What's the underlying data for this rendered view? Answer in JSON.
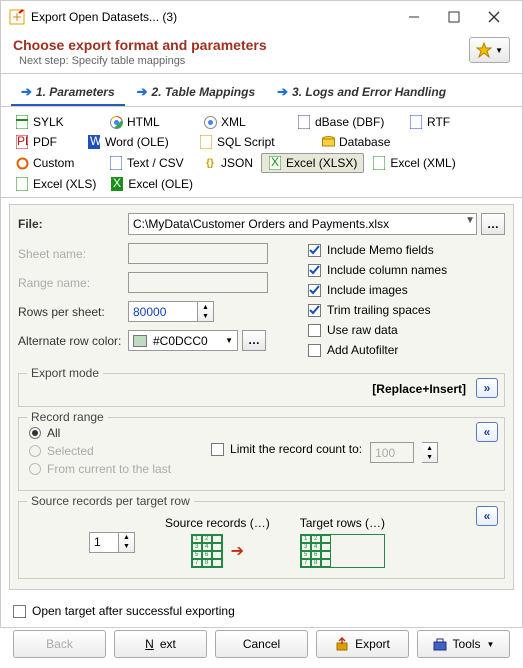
{
  "window": {
    "title": "Export Open Datasets... (3)"
  },
  "header": {
    "title": "Choose export format and parameters",
    "subtitle": "Next step: Specify table mappings"
  },
  "tabs": [
    {
      "label": "1. Parameters",
      "active": true
    },
    {
      "label": "2. Table Mappings",
      "active": false
    },
    {
      "label": "3. Logs and Error Handling",
      "active": false
    }
  ],
  "formats": [
    {
      "label": "SYLK",
      "color": "#1a8f1a"
    },
    {
      "label": "HTML",
      "color": "#e04020"
    },
    {
      "label": "XML",
      "color": "#e04020"
    },
    {
      "label": "dBase (DBF)",
      "color": "#5a3fa0"
    },
    {
      "label": "RTF",
      "color": "#2050c0"
    },
    {
      "label": "PDF",
      "color": "#c01515"
    },
    {
      "label": "Word (OLE)",
      "color": "#2050c0"
    },
    {
      "label": "SQL Script",
      "color": "#cc9900"
    },
    {
      "label": "Database",
      "color": "#cc9900"
    },
    {
      "label": "Custom",
      "color": "#e06000"
    },
    {
      "label": "Text / CSV",
      "color": "#2050c0"
    },
    {
      "label": "JSON",
      "color": "#cc9900"
    },
    {
      "label": "Excel (XLSX)",
      "color": "#1a8f1a",
      "selected": true
    },
    {
      "label": "Excel (XML)",
      "color": "#1a8f1a"
    },
    {
      "label": "Excel (XLS)",
      "color": "#1a8f1a"
    },
    {
      "label": "Excel (OLE)",
      "color": "#1a8f1a"
    }
  ],
  "file": {
    "label": "File:",
    "value": "C:\\MyData\\Customer Orders and Payments.xlsx"
  },
  "sheet": {
    "label": "Sheet name:",
    "value": ""
  },
  "range": {
    "label": "Range name:",
    "value": ""
  },
  "rows_per_sheet": {
    "label": "Rows per sheet:",
    "value": "80000"
  },
  "alt_color": {
    "label": "Alternate row color:",
    "value": "#C0DCC0",
    "swatch": "#C0DCC0"
  },
  "options": {
    "memo": {
      "label": "Include Memo fields",
      "checked": true
    },
    "cols": {
      "label": "Include column names",
      "checked": true
    },
    "images": {
      "label": "Include images",
      "checked": true
    },
    "trim": {
      "label": "Trim trailing spaces",
      "checked": true
    },
    "raw": {
      "label": "Use raw data",
      "checked": false
    },
    "autof": {
      "label": "Add Autofilter",
      "checked": false
    }
  },
  "export_mode": {
    "label": "Export mode",
    "value": "[Replace+Insert]"
  },
  "record_range": {
    "label": "Record range",
    "all": "All",
    "selected": "Selected",
    "from_current": "From current to the last",
    "limit_label": "Limit the record count to:",
    "limit_value": "100"
  },
  "per_row": {
    "label": "Source records per target row",
    "value": "1",
    "src_label": "Source records (…)",
    "tgt_label": "Target rows (…)"
  },
  "footer": {
    "open_after": "Open target after successful exporting"
  },
  "buttons": {
    "back": "Back",
    "next": "Next",
    "cancel": "Cancel",
    "export": "Export",
    "tools": "Tools"
  }
}
